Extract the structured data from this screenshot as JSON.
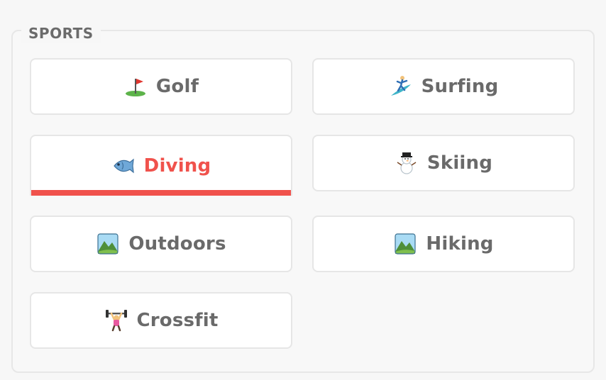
{
  "section": {
    "title": "SPORTS"
  },
  "tiles": [
    {
      "label": "Golf",
      "icon": "golf-flag-icon"
    },
    {
      "label": "Surfing",
      "icon": "surfer-icon"
    },
    {
      "label": "Diving",
      "icon": "fish-icon",
      "selected": true
    },
    {
      "label": "Skiing",
      "icon": "snowman-icon"
    },
    {
      "label": "Outdoors",
      "icon": "landscape-icon"
    },
    {
      "label": "Hiking",
      "icon": "landscape-icon"
    },
    {
      "label": "Crossfit",
      "icon": "weightlifter-icon"
    }
  ],
  "colors": {
    "accent": "#f0524c",
    "text": "#6a6a6a",
    "border": "#e6e6e6"
  }
}
